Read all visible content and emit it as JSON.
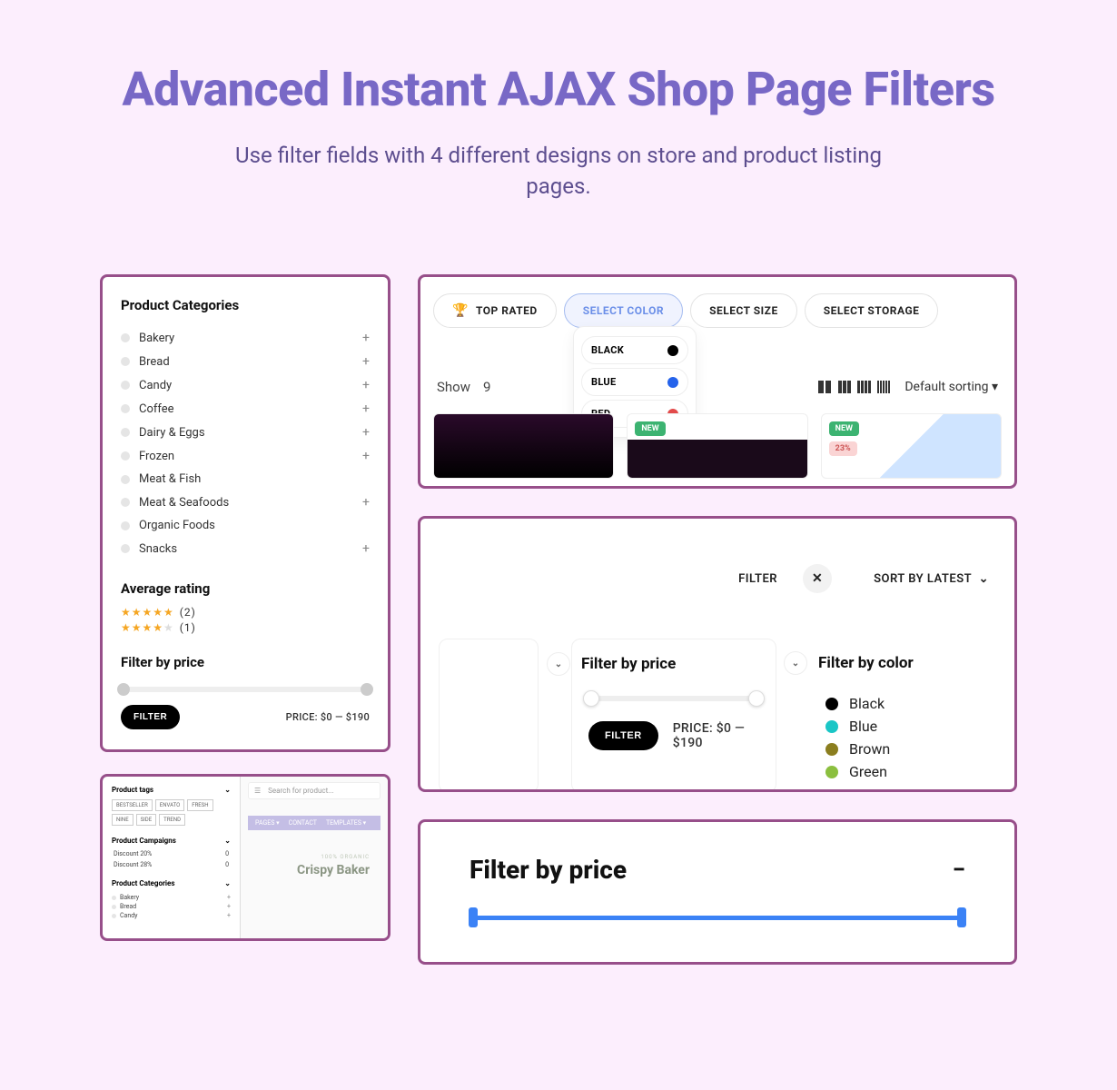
{
  "header": {
    "title": "Advanced Instant AJAX Shop Page Filters",
    "subtitle": "Use filter fields with 4 different designs on store and product listing pages."
  },
  "panel1": {
    "heading": "Product Categories",
    "cats": [
      {
        "name": "Bakery",
        "exp": true
      },
      {
        "name": "Bread",
        "exp": true
      },
      {
        "name": "Candy",
        "exp": true
      },
      {
        "name": "Coffee",
        "exp": true
      },
      {
        "name": "Dairy & Eggs",
        "exp": true
      },
      {
        "name": "Frozen",
        "exp": true
      },
      {
        "name": "Meat & Fish",
        "exp": false
      },
      {
        "name": "Meat & Seafoods",
        "exp": true
      },
      {
        "name": "Organic Foods",
        "exp": false
      },
      {
        "name": "Snacks",
        "exp": true
      }
    ],
    "rating_h": "Average rating",
    "ratings": [
      {
        "stars": 5,
        "count": "(2)"
      },
      {
        "stars": 4,
        "count": "(1)"
      }
    ],
    "price_h": "Filter by price",
    "filter_btn": "FILTER",
    "price_label": "PRICE: $0 — $190"
  },
  "panel2": {
    "pills": [
      {
        "label": "TOP RATED",
        "emoji": "🏆"
      },
      {
        "label": "SELECT COLOR"
      },
      {
        "label": "SELECT SIZE"
      },
      {
        "label": "SELECT STORAGE"
      }
    ],
    "colors": [
      {
        "name": "BLACK",
        "hex": "#000"
      },
      {
        "name": "BLUE",
        "hex": "#2563EB"
      },
      {
        "name": "RED",
        "hex": "#E24A4A"
      }
    ],
    "show": "Show",
    "show_n": "9",
    "sort": "Default sorting",
    "new": "NEW",
    "pct": "23%"
  },
  "panel3": {
    "filter": "FILTER",
    "sort": "SORT BY LATEST",
    "fprice": "Filter by price",
    "fcolor": "Filter by color",
    "filter_btn": "FILTER",
    "price_label": "PRICE: $0 — $190",
    "colors": [
      {
        "name": "Black",
        "hex": "#000"
      },
      {
        "name": "Blue",
        "hex": "#1AC6C6"
      },
      {
        "name": "Brown",
        "hex": "#8B7E1F"
      },
      {
        "name": "Green",
        "hex": "#8BBF3F"
      }
    ]
  },
  "panel4": {
    "tags_h": "Product tags",
    "tags": [
      "BESTSELLER",
      "ENVATO",
      "FRESH",
      "NINE",
      "SIDE",
      "TREND"
    ],
    "camp_h": "Product Campaigns",
    "camps": [
      "Discount 20%",
      "Discount 28%"
    ],
    "cats_h": "Product Categories",
    "cats": [
      "Bakery",
      "Bread",
      "Candy"
    ],
    "search": "Search for product...",
    "nav": [
      "PAGES",
      "CONTACT",
      "TEMPLATES"
    ],
    "overline": "100% ORGANIC",
    "hero": "Crispy Baker"
  },
  "panel5": {
    "h": "Filter by price"
  }
}
